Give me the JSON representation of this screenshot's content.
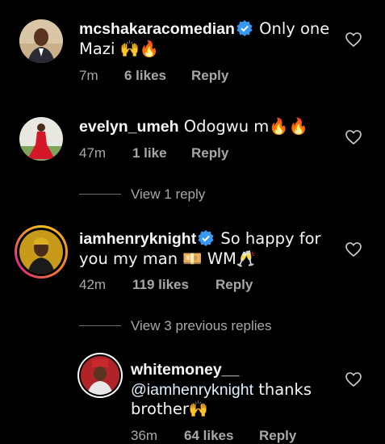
{
  "comments": [
    {
      "username": "mcshakaracomedian",
      "verified": true,
      "text": " Only one Mazi 🙌🔥",
      "time": "7m",
      "likes": "6 likes",
      "reply": "Reply"
    },
    {
      "username": "evelyn_umeh",
      "verified": false,
      "text": " Odogwu m🔥🔥",
      "time": "47m",
      "likes": "1 like",
      "reply": "Reply",
      "view_replies": "View 1 reply"
    },
    {
      "username": "iamhenryknight",
      "verified": true,
      "text": " So happy for you my man 💴 WM🥂",
      "time": "42m",
      "likes": "119 likes",
      "reply": "Reply",
      "view_replies": "View 3 previous replies"
    },
    {
      "username": "whitemoney__",
      "verified": false,
      "mention": "@iamhenryknight",
      "text": " thanks brother🙌",
      "time": "36m",
      "likes": "64 likes",
      "reply": "Reply"
    }
  ],
  "colors": {
    "background": "#000000",
    "text": "#f5f5f5",
    "meta": "#a8a8a8",
    "verified": "#3897f0",
    "mention": "#e0f1ff"
  },
  "icons": [
    "verified-badge-icon",
    "heart-icon"
  ]
}
